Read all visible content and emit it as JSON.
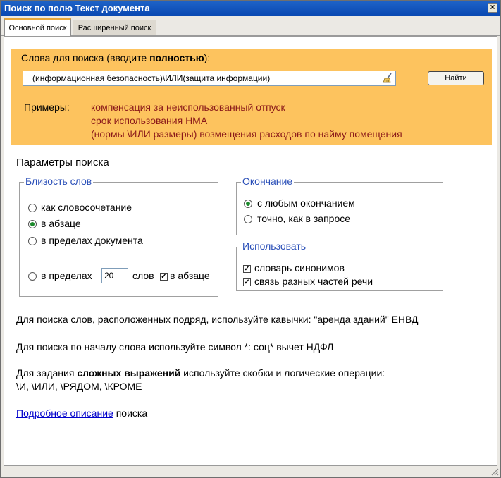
{
  "window": {
    "title": "Поиск по полю Текст документа",
    "close_glyph": "×"
  },
  "tabs": [
    {
      "label": "Основной поиск",
      "active": true
    },
    {
      "label": "Расширенный поиск",
      "active": false
    }
  ],
  "search": {
    "prompt_prefix": "Слова для поиска (вводите ",
    "prompt_bold": "полностью",
    "prompt_suffix": "):",
    "value": "(информационная безопасность)\\ИЛИ(защита информации)",
    "find_button": "Найти",
    "examples_label": "Примеры:",
    "examples": [
      "компенсация за неиспользованный отпуск",
      "срок использования НМА",
      "(нормы \\ИЛИ размеры) возмещения расходов по найму помещения"
    ]
  },
  "params": {
    "heading": "Параметры поиска",
    "proximity": {
      "legend": "Близость слов",
      "options": [
        "как словосочетание",
        "в абзаце",
        "в пределах документа"
      ],
      "selected_index": 1,
      "within_label": "в пределах",
      "within_value": "20",
      "words_label": "слов",
      "in_paragraph_label": "в абзаце",
      "in_paragraph_checked": true
    },
    "ending": {
      "legend": "Окончание",
      "options": [
        "с любым окончанием",
        "точно, как в запросе"
      ],
      "selected_index": 0
    },
    "use": {
      "legend": "Использовать",
      "items": [
        {
          "label": "словарь синонимов",
          "checked": true
        },
        {
          "label": "связь разных частей речи",
          "checked": true
        }
      ]
    }
  },
  "hints": {
    "quotes": "Для поиска слов, расположенных подряд, используйте кавычки: \"аренда зданий\" ЕНВД",
    "prefix": "Для поиска по началу слова используйте символ *: соц* вычет НДФЛ",
    "complex_prefix": "Для задания ",
    "complex_bold": "сложных выражений",
    "complex_suffix": " используйте скобки и логические операции:",
    "operators": "\\И, \\ИЛИ, \\РЯДОМ, \\КРОМЕ",
    "more_link": "Подробное описание",
    "more_suffix": " поиска"
  },
  "colors": {
    "title_bar": "#0a49b3",
    "search_bg": "#fdc35e",
    "examples_text": "#8b1a1a",
    "legend_text": "#2a4fb8",
    "radio_selected": "#1c8a2c"
  }
}
